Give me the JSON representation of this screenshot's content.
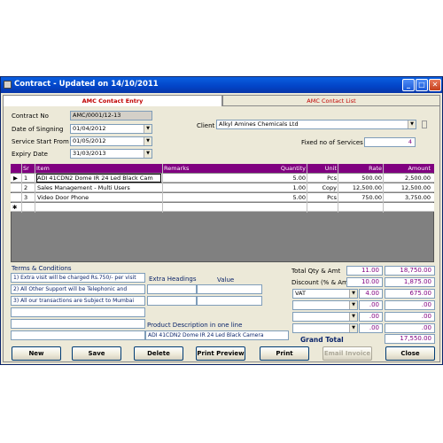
{
  "window": {
    "title": "Contract - Updated on 14/10/2011",
    "controls": [
      "_",
      "□",
      "✕"
    ]
  },
  "tabs": [
    {
      "label": "AMC Contact Entry"
    },
    {
      "label": "AMC Contact List"
    }
  ],
  "form": {
    "contract_no_label": "Contract No",
    "contract_no": "AMC/0001/12-13",
    "singning_label": "Date of Singning",
    "singning_date": "01/04/2012",
    "service_start_label": "Service Start From",
    "service_start": "01/05/2012",
    "expiry_label": "Expiry Date",
    "expiry": "31/03/2013",
    "client_label": "Client",
    "client": "Alkyl Amines Chemicals Ltd",
    "fixed_services_label": "Fixed no of Services",
    "fixed_services": "4"
  },
  "grid": {
    "headers": [
      "Sr",
      "Item",
      "Remarks",
      "Quantity",
      "Unit",
      "Rate",
      "Amount"
    ],
    "rows": [
      {
        "sr": "1",
        "item": "ADI 41CDN2 Dome IR 24 Led Black Cam",
        "remarks": "",
        "qty": "5.00",
        "unit": "Pcs",
        "rate": "500.00",
        "amount": "2,500.00"
      },
      {
        "sr": "2",
        "item": "Sales Management - Multi Users",
        "remarks": "",
        "qty": "1.00",
        "unit": "Copy",
        "rate": "12,500.00",
        "amount": "12,500.00"
      },
      {
        "sr": "3",
        "item": "Video Door Phone",
        "remarks": "",
        "qty": "5.00",
        "unit": "Pcs",
        "rate": "750.00",
        "amount": "3,750.00"
      }
    ],
    "new_row_marker": "✱",
    "current_row_marker": "▶"
  },
  "terms": {
    "label": "Terms & Conditions",
    "items": [
      "1) Extra visit will be charged Rs.750/- per visit",
      "2) All Other Support will be Telephonic and",
      "3) All our transactions are Subject to Mumbai"
    ]
  },
  "extra": {
    "heading_label": "Extra Headings",
    "value_label": "Value"
  },
  "product_desc": {
    "label": "Product Description in one line",
    "value": "ADI 41CDN2 Dome IR 24 Led Black Camera"
  },
  "totals": {
    "qty_amt_label": "Total Qty & Amt",
    "total_qty": "11.00",
    "total_amt": "18,750.00",
    "discount_label": "Discount (% & Amt)",
    "discount_pct": "10.00",
    "discount_amt": "1,875.00",
    "tax_name": "VAT",
    "tax_pct": "4.00",
    "tax_amt": "675.00",
    "extra1_pct": ".00",
    "extra1_amt": ".00",
    "extra2_pct": ".00",
    "extra2_amt": ".00",
    "extra3_pct": ".00",
    "extra3_amt": ".00",
    "grand_total_label": "Grand Total",
    "grand_total": "17,550.00"
  },
  "buttons": {
    "new": "New",
    "save": "Save",
    "delete": "Delete",
    "print_preview": "Print Preview",
    "print": "Print",
    "email_invoice": "Email Invoice",
    "close": "Close"
  },
  "colors": {
    "title_bar": "#0243c6",
    "grid_header": "#800080",
    "tab_text": "#c00000",
    "accent_text": "#800080"
  }
}
